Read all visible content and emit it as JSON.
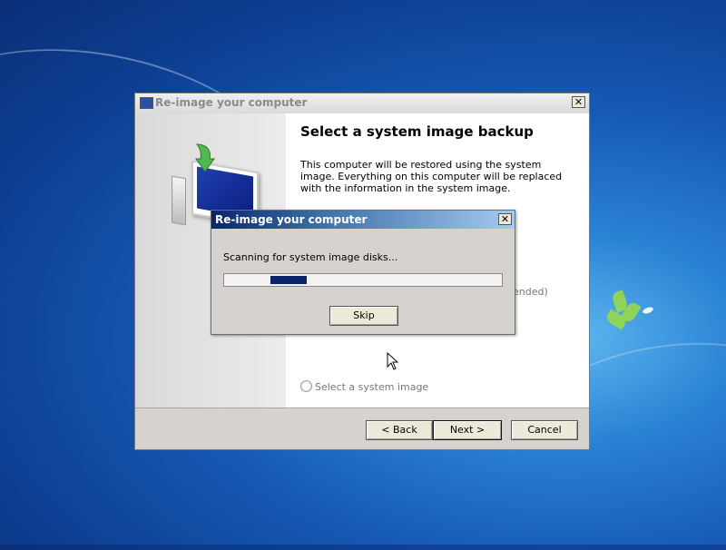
{
  "main_window": {
    "title": "Re-image your computer",
    "heading": "Select a system image backup",
    "description": "This computer will be restored using the system image. Everything on this computer will be replaced with the information in the system image.",
    "option_fragment": "ended)",
    "radio_option_label": "Select a system image",
    "buttons": {
      "back": "< Back",
      "next": "Next >",
      "cancel": "Cancel"
    },
    "close_glyph": "✕"
  },
  "progress_dialog": {
    "title": "Re-image your computer",
    "message": "Scanning for system image disks...",
    "progress": {
      "indeterminate": true,
      "block_start_fraction": 0.16,
      "block_width_fraction": 0.13
    },
    "skip_label": "Skip",
    "close_glyph": "✕"
  },
  "colors": {
    "dialog_title_start": "#0a246a",
    "progress_fill": "#0a246a",
    "desktop": "#1659b4"
  },
  "icons": [
    "computer-restore-icon",
    "mouse-cursor-icon",
    "close-icon",
    "app-icon"
  ]
}
